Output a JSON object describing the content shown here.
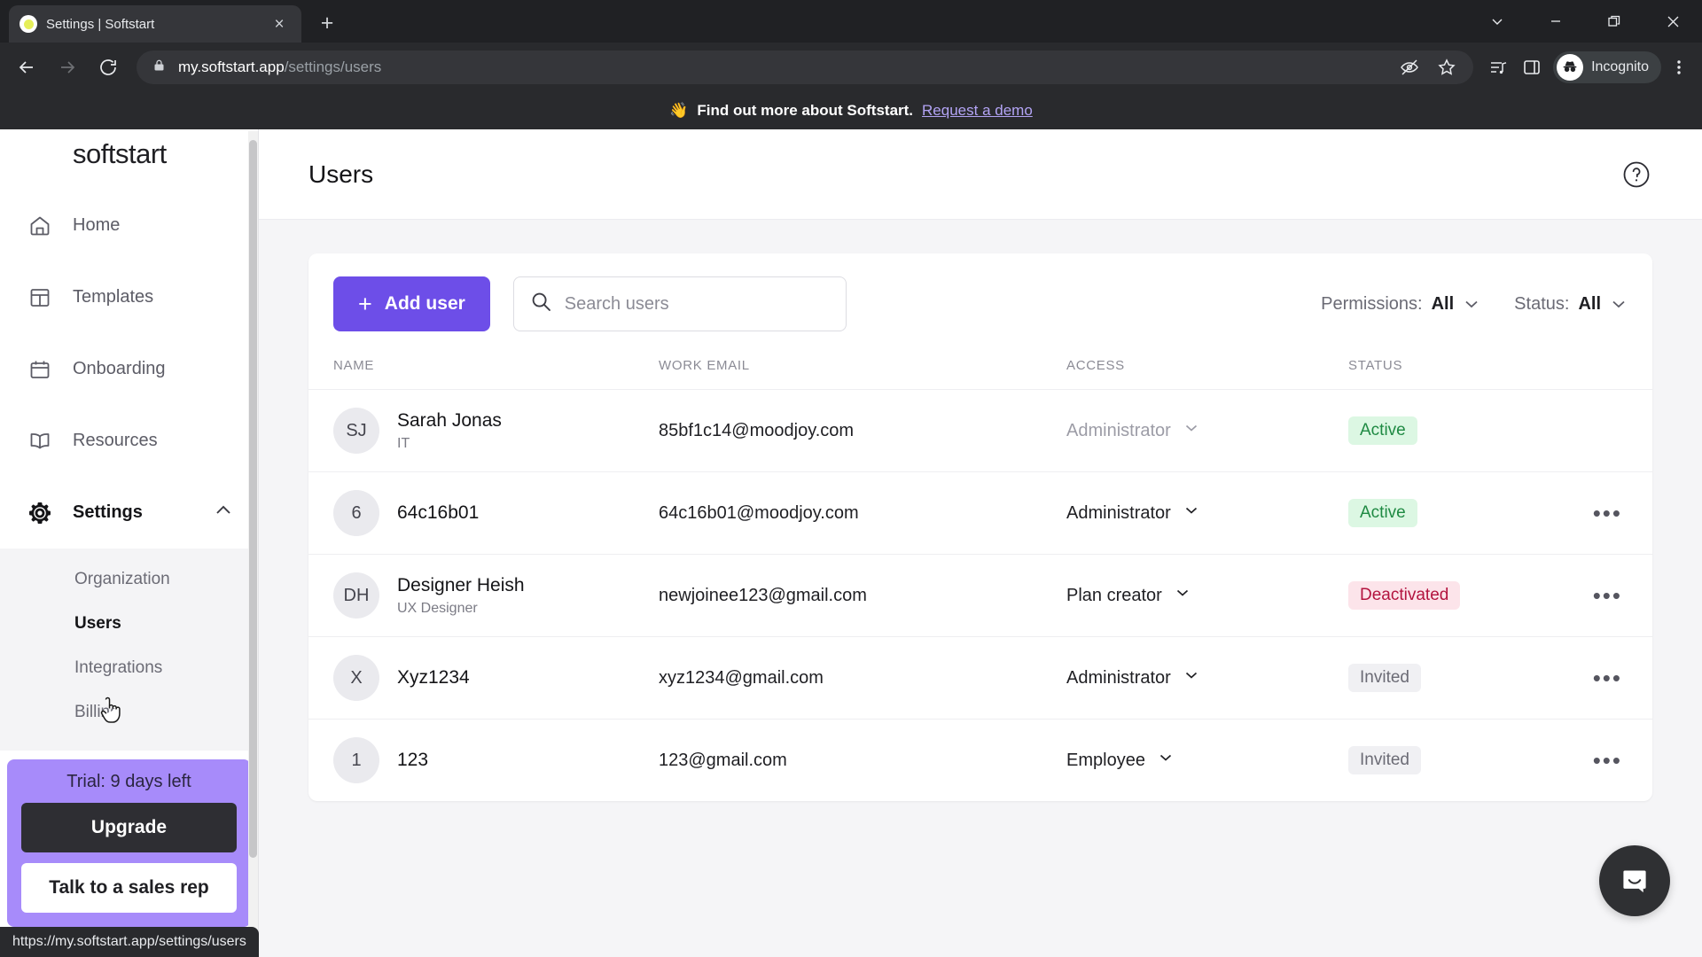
{
  "browser": {
    "tab": {
      "title": "Settings | Softstart",
      "favicon": "softstart-favicon",
      "close": "×"
    },
    "new_tab_label": "+",
    "window_controls": [
      "tab-search-chevron",
      "minimize",
      "maximize",
      "close"
    ],
    "url_host": "my.softstart.app",
    "url_path": "/settings/users",
    "profile_label": "Incognito",
    "toolbar_icons": [
      "eye-off-icon",
      "bookmark-star-icon",
      "reading-list-icon",
      "side-panel-icon"
    ],
    "menu_icon": "three-dot-menu-icon",
    "status_bar_url": "https://my.softstart.app/settings/users"
  },
  "banner": {
    "emoji": "👋",
    "text": "Find out more about Softstart.",
    "link": "Request a demo",
    "link_color": "#b3a4f5"
  },
  "sidebar": {
    "brand": "softstart",
    "items": [
      {
        "label": "Home",
        "icon": "home-icon"
      },
      {
        "label": "Templates",
        "icon": "templates-icon"
      },
      {
        "label": "Onboarding",
        "icon": "calendar-icon"
      },
      {
        "label": "Resources",
        "icon": "book-icon"
      },
      {
        "label": "Settings",
        "icon": "gear-icon",
        "active": true,
        "chevron": "chevron-up-icon"
      }
    ],
    "submenu": [
      {
        "label": "Organization"
      },
      {
        "label": "Users",
        "active": true
      },
      {
        "label": "Integrations"
      },
      {
        "label": "Billing"
      }
    ],
    "trial": {
      "text": "Trial: 9 days left",
      "upgrade_label": "Upgrade",
      "sales_label": "Talk to a sales rep",
      "bg_color": "#a78bfa"
    }
  },
  "page": {
    "title": "Users",
    "help_icon": "help-circle-icon"
  },
  "toolbar": {
    "add_user_label": "Add user",
    "add_user_plus": "+",
    "add_user_color": "#6d4ee8",
    "search_placeholder": "Search users",
    "search_value": "",
    "search_icon": "search-icon",
    "filters": [
      {
        "label": "Permissions:",
        "value": "All"
      },
      {
        "label": "Status:",
        "value": "All"
      }
    ]
  },
  "table": {
    "columns": [
      "NAME",
      "WORK EMAIL",
      "ACCESS",
      "STATUS"
    ],
    "rows": [
      {
        "initials": "SJ",
        "name": "Sarah Jonas",
        "role": "IT",
        "email": "85bf1c14@moodjoy.com",
        "access": "Administrator",
        "access_muted": true,
        "status": "Active",
        "status_type": "active",
        "has_menu": false,
        "menu": ""
      },
      {
        "initials": "6",
        "name": "64c16b01",
        "role": "",
        "email": "64c16b01@moodjoy.com",
        "access": "Administrator",
        "access_muted": false,
        "status": "Active",
        "status_type": "active",
        "has_menu": true,
        "menu": "•••"
      },
      {
        "initials": "DH",
        "name": "Designer Heish",
        "role": "UX Designer",
        "email": "newjoinee123@gmail.com",
        "access": "Plan creator",
        "access_muted": false,
        "status": "Deactivated",
        "status_type": "deactivated",
        "has_menu": true,
        "menu": "•••"
      },
      {
        "initials": "X",
        "name": "Xyz1234",
        "role": "",
        "email": "xyz1234@gmail.com",
        "access": "Administrator",
        "access_muted": false,
        "status": "Invited",
        "status_type": "invited",
        "has_menu": true,
        "menu": "•••"
      },
      {
        "initials": "1",
        "name": "123",
        "role": "",
        "email": "123@gmail.com",
        "access": "Employee",
        "access_muted": false,
        "status": "Invited",
        "status_type": "invited",
        "has_menu": true,
        "menu": "•••"
      }
    ]
  },
  "chat": {
    "icon": "intercom-chat-icon"
  },
  "colors": {
    "accent_purple": "#6d4ee8",
    "trial_purple": "#a78bfa",
    "active_green_bg": "#dcf7e3",
    "active_green_fg": "#1f8a43",
    "deactivated_bg": "#fce4ea",
    "deactivated_fg": "#b3143f",
    "invited_bg": "#f0f0f3",
    "invited_fg": "#6b6b75"
  }
}
